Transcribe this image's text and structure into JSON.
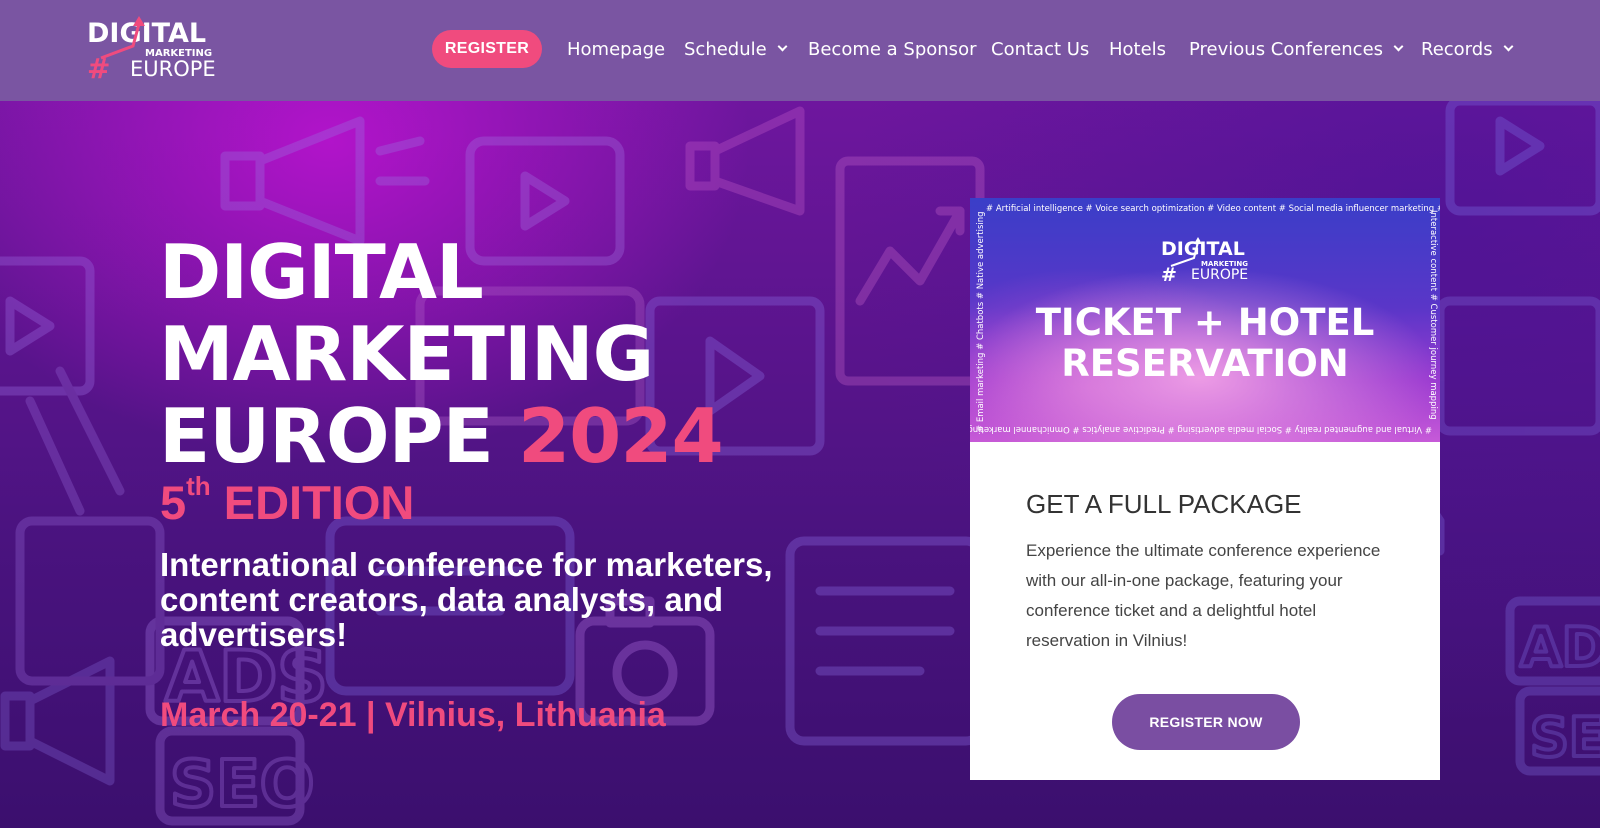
{
  "header": {
    "logo": {
      "line1": "DIGITAL",
      "line2": "MARKETING",
      "line3": "EUROPE",
      "hash": "#"
    },
    "register_label": "REGISTER",
    "nav": [
      {
        "label": "Homepage"
      },
      {
        "label": "Schedule"
      },
      {
        "label": "Become a Sponsor"
      },
      {
        "label": "Contact Us"
      },
      {
        "label": "Hotels"
      },
      {
        "label": "Previous Conferences"
      },
      {
        "label": "Records"
      }
    ]
  },
  "hero": {
    "title_line1": "DIGITAL",
    "title_line2": "MARKETING",
    "title_line3": "EUROPE",
    "title_year": "2024",
    "edition_number": "5",
    "edition_suffix": "th",
    "edition_word": "EDITION",
    "subtitle": "International conference for marketers, content creators, data analysts, and advertisers!",
    "date_location": "March 20-21 | Vilnius, Lithuania"
  },
  "promo": {
    "tags_top": "# Artificial intelligence  # Voice search optimization  # Video content  # Social media influencer marketing  #",
    "tags_right": "Interactive content  # Customer journey mapping",
    "tags_bottom": "# Virtual and augmented reality  # Social media advertising  # Predictive analytics  # Omnichannel marketing",
    "tags_left": "# Email marketing  # Chatbots  # Native advertising",
    "logo": {
      "line1": "DIGITAL",
      "line2": "MARKETING",
      "line3": "EUROPE",
      "hash": "#"
    },
    "title_line1": "TICKET + HOTEL",
    "title_line2": "RESERVATION",
    "heading": "GET A FULL PACKAGE",
    "text": "Experience the ultimate conference experience with our all-in-one package, featuring your conference ticket and a delightful hotel reservation in Vilnius!",
    "button_label": "REGISTER NOW"
  },
  "colors": {
    "header_bg": "#7a55a2",
    "accent_pink": "#f04b7e",
    "button_purple": "#7a4ea2",
    "hero_dark": "#3a0d6b"
  },
  "icons": [
    "chevron-down-icon",
    "arrow-up-icon",
    "megaphone-icon",
    "play-icon",
    "camera-icon",
    "chart-icon",
    "ads-icon",
    "seo-icon",
    "email-icon"
  ]
}
